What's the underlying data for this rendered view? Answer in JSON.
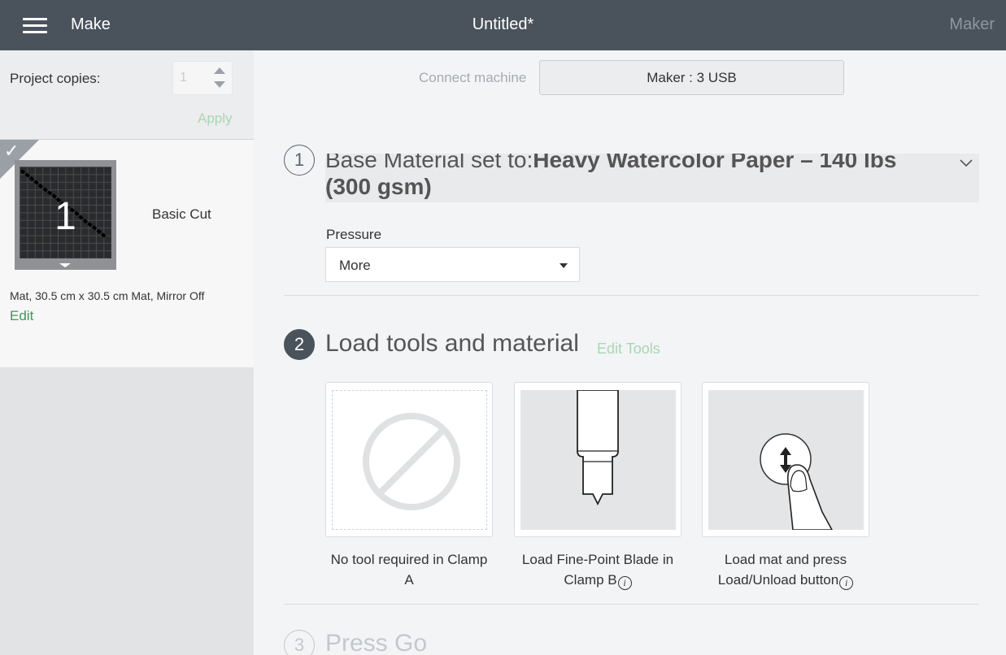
{
  "topbar": {
    "make_label": "Make",
    "title": "Untitled*",
    "machine_label": "Maker"
  },
  "sidebar": {
    "copies_label": "Project copies:",
    "copies_value": "1",
    "apply_label": "Apply",
    "mat": {
      "number": "1",
      "label": "Basic Cut",
      "description": "Mat, 30.5 cm x 30.5 cm Mat, Mirror Off",
      "edit_label": "Edit"
    }
  },
  "connect": {
    "label": "Connect machine",
    "button_label": "Maker : 3 USB"
  },
  "step1": {
    "number": "1",
    "prefix": "Base Material set to:",
    "material": "Heavy Watercolor Paper – 140 lbs (300 gsm)",
    "pressure_label": "Pressure",
    "pressure_value": "More"
  },
  "step2": {
    "number": "2",
    "title": "Load tools and material",
    "edit_tools_label": "Edit Tools",
    "cards": [
      {
        "caption": "No tool required in Clamp A",
        "icon": "no-tool-icon"
      },
      {
        "caption": "Load Fine-Point Blade in Clamp B",
        "icon": "fine-point-blade-icon"
      },
      {
        "caption": "Load mat and press Load/Unload button",
        "icon": "load-unload-button-icon"
      }
    ],
    "info_glyph": "i"
  },
  "step3": {
    "number": "3",
    "title": "Press Go"
  },
  "colors": {
    "topbar": "#4a535c",
    "accent_green": "#3a9a56",
    "light_green": "#a8d6b5"
  }
}
